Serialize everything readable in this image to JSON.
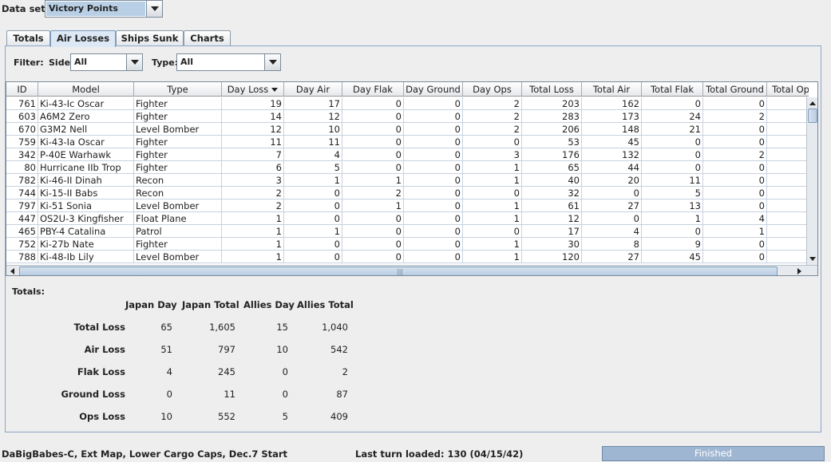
{
  "dataset": {
    "label": "Data set:",
    "value": "Victory Points"
  },
  "tabs": [
    {
      "label": "Totals"
    },
    {
      "label": "Air Losses"
    },
    {
      "label": "Ships Sunk"
    },
    {
      "label": "Charts"
    }
  ],
  "active_tab": "Air Losses",
  "filter": {
    "label": "Filter:",
    "side_label": "Side:",
    "side_value": "All",
    "type_label": "Type:",
    "type_value": "All"
  },
  "table": {
    "columns": [
      "ID",
      "Model",
      "Type",
      "Day Loss",
      "Day Air",
      "Day Flak",
      "Day Ground",
      "Day Ops",
      "Total Loss",
      "Total Air",
      "Total Flak",
      "Total Ground",
      "Total Op"
    ],
    "sorted_column": "Day Loss",
    "rows": [
      [
        "761",
        "Ki-43-Ic Oscar",
        "Fighter",
        "19",
        "17",
        "0",
        "0",
        "2",
        "203",
        "162",
        "0",
        "0",
        ""
      ],
      [
        "603",
        "A6M2 Zero",
        "Fighter",
        "14",
        "12",
        "0",
        "0",
        "2",
        "283",
        "173",
        "24",
        "2",
        ""
      ],
      [
        "670",
        "G3M2 Nell",
        "Level Bomber",
        "12",
        "10",
        "0",
        "0",
        "2",
        "206",
        "148",
        "21",
        "0",
        ""
      ],
      [
        "759",
        "Ki-43-Ia Oscar",
        "Fighter",
        "11",
        "11",
        "0",
        "0",
        "0",
        "53",
        "45",
        "0",
        "0",
        ""
      ],
      [
        "342",
        "P-40E Warhawk",
        "Fighter",
        "7",
        "4",
        "0",
        "0",
        "3",
        "176",
        "132",
        "0",
        "2",
        ""
      ],
      [
        "80",
        "Hurricane IIb Trop",
        "Fighter",
        "6",
        "5",
        "0",
        "0",
        "1",
        "65",
        "44",
        "0",
        "0",
        ""
      ],
      [
        "782",
        "Ki-46-II Dinah",
        "Recon",
        "3",
        "1",
        "1",
        "0",
        "1",
        "40",
        "20",
        "11",
        "0",
        ""
      ],
      [
        "744",
        "Ki-15-II Babs",
        "Recon",
        "2",
        "0",
        "2",
        "0",
        "0",
        "32",
        "0",
        "5",
        "0",
        ""
      ],
      [
        "797",
        "Ki-51 Sonia",
        "Level Bomber",
        "2",
        "0",
        "1",
        "0",
        "1",
        "61",
        "27",
        "13",
        "0",
        ""
      ],
      [
        "447",
        "OS2U-3 Kingfisher",
        "Float Plane",
        "1",
        "0",
        "0",
        "0",
        "1",
        "12",
        "0",
        "1",
        "4",
        ""
      ],
      [
        "465",
        "PBY-4 Catalina",
        "Patrol",
        "1",
        "1",
        "0",
        "0",
        "0",
        "17",
        "4",
        "0",
        "1",
        ""
      ],
      [
        "752",
        "Ki-27b Nate",
        "Fighter",
        "1",
        "0",
        "0",
        "0",
        "1",
        "30",
        "8",
        "9",
        "0",
        ""
      ],
      [
        "788",
        "Ki-48-Ib Lily",
        "Level Bomber",
        "1",
        "0",
        "0",
        "0",
        "1",
        "120",
        "27",
        "45",
        "0",
        ""
      ]
    ]
  },
  "totals": {
    "title": "Totals:",
    "columns": [
      "Japan Day",
      "Japan Total",
      "Allies Day",
      "Allies Total"
    ],
    "rows": [
      {
        "label": "Total Loss",
        "values": [
          "65",
          "1,605",
          "15",
          "1,040"
        ]
      },
      {
        "label": "Air Loss",
        "values": [
          "51",
          "797",
          "10",
          "542"
        ]
      },
      {
        "label": "Flak Loss",
        "values": [
          "4",
          "245",
          "0",
          "2"
        ]
      },
      {
        "label": "Ground Loss",
        "values": [
          "0",
          "11",
          "0",
          "87"
        ]
      },
      {
        "label": "Ops Loss",
        "values": [
          "10",
          "552",
          "5",
          "409"
        ]
      }
    ]
  },
  "status": {
    "scenario": "DaBigBabes-C, Ext Map, Lower Cargo Caps, Dec.7 Start",
    "last_turn": "Last turn loaded: 130 (04/15/42)",
    "progress_label": "Finished",
    "progress": 1.0
  },
  "colors": {
    "selection": "#b8cfe5",
    "grid": "#c7d2de",
    "progress": "#aabfd8"
  }
}
